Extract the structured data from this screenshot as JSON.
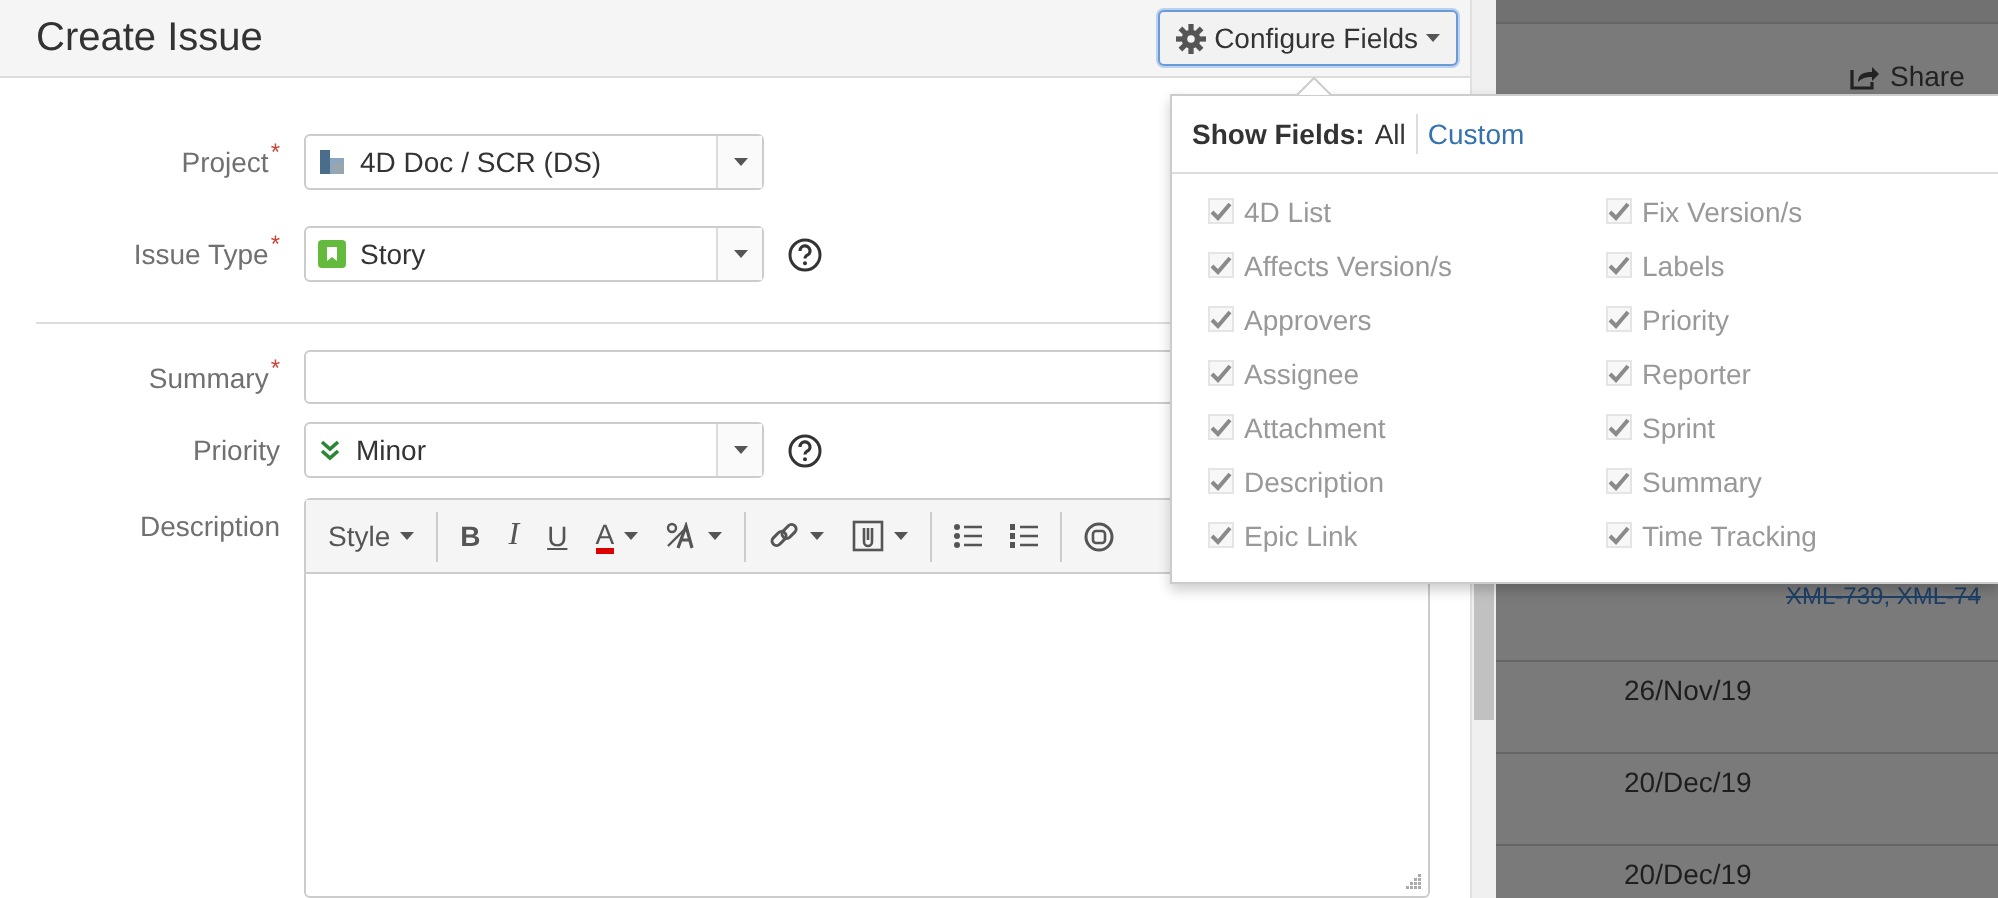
{
  "dialog": {
    "title": "Create Issue",
    "configure_button": {
      "label": "Configure Fields",
      "focused": true
    },
    "sections": [
      [
        {
          "kind": "project",
          "label": "Project",
          "required_mark": "*",
          "value": "4D Doc / SCR (DS)",
          "help": false
        },
        {
          "kind": "issue-type",
          "label": "Issue Type",
          "required_mark": "*",
          "value": "Story",
          "help": true
        }
      ],
      [
        {
          "kind": "text",
          "label": "Summary",
          "required_mark": "*"
        },
        {
          "kind": "priority",
          "label": "Priority",
          "value": "Minor",
          "help": true
        },
        {
          "kind": "editor",
          "label": "Description",
          "toolbar": [
            [
              {
                "kind": "style",
                "label": "Style",
                "dropdown": true
              }
            ],
            [
              {
                "kind": "bold",
                "label": "B"
              },
              {
                "kind": "italic",
                "label": "I"
              },
              {
                "kind": "underline",
                "label": "U"
              },
              {
                "kind": "color",
                "label": "A",
                "dropdown": true
              },
              {
                "kind": "clear-format",
                "dropdown": true
              }
            ],
            [
              {
                "kind": "link",
                "dropdown": true
              },
              {
                "kind": "attachment",
                "dropdown": true
              }
            ],
            [
              {
                "kind": "bullet-list"
              },
              {
                "kind": "numbered-list"
              }
            ],
            [
              {
                "kind": "emoji"
              }
            ]
          ]
        }
      ]
    ]
  },
  "popup": {
    "title": "Show Fields:",
    "options": [
      {
        "label": "All",
        "selected": true
      },
      {
        "label": "Custom",
        "selected": false
      }
    ],
    "fields": [
      {
        "label": "4D List",
        "checked": true
      },
      {
        "label": "Affects Version/s",
        "checked": true
      },
      {
        "label": "Approvers",
        "checked": true
      },
      {
        "label": "Assignee",
        "checked": true
      },
      {
        "label": "Attachment",
        "checked": true
      },
      {
        "label": "Description",
        "checked": true
      },
      {
        "label": "Epic Link",
        "checked": true
      },
      {
        "label": "Fix Version/s",
        "checked": true
      },
      {
        "label": "Labels",
        "checked": true
      },
      {
        "label": "Priority",
        "checked": true
      },
      {
        "label": "Reporter",
        "checked": true
      },
      {
        "label": "Sprint",
        "checked": true
      },
      {
        "label": "Summary",
        "checked": true
      },
      {
        "label": "Time Tracking",
        "checked": true
      }
    ]
  },
  "background": {
    "share_button": "Share",
    "rows": [
      {
        "column_2": "XML-739, XML-74",
        "struck": true
      },
      {
        "column_1": "26/Nov/19"
      },
      {
        "column_1": "20/Dec/19"
      },
      {
        "column_1": "20/Dec/19"
      }
    ]
  }
}
